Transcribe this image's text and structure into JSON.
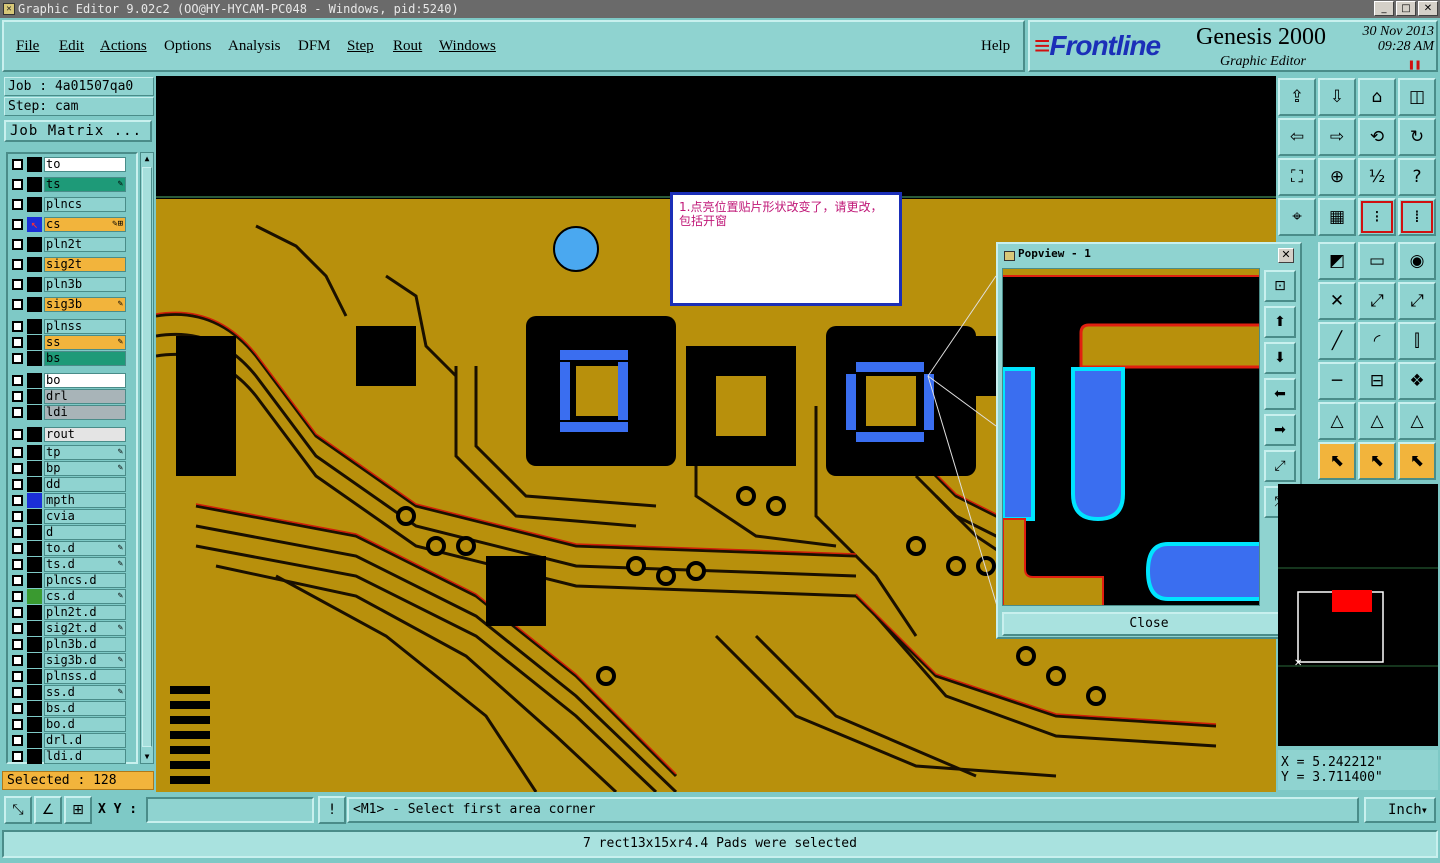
{
  "window": {
    "title": "Graphic Editor 9.02c2 (OO@HY-HYCAM-PC048 - Windows, pid:5240)",
    "min": "_",
    "max": "□",
    "close": "✕"
  },
  "menu": {
    "file": "File",
    "edit": "Edit",
    "actions": "Actions",
    "options": "Options",
    "analysis": "Analysis",
    "dfm": "DFM",
    "step": "Step",
    "rout": "Rout",
    "windows": "Windows",
    "help": "Help"
  },
  "brand": {
    "logo": "Frontline",
    "product": "Genesis 2000",
    "subtitle": "Graphic Editor",
    "date": "30 Nov 2013",
    "time": "09:28 AM",
    "pause_glyph": "❚❚"
  },
  "job": {
    "job_label": "Job : 4a01507qa0",
    "step_label": "Step: cam",
    "matrix_button": "Job Matrix ..."
  },
  "layers": [
    {
      "name": "to",
      "bg": "#ffffff",
      "mark": ""
    },
    {
      "name": "ts",
      "bg": "#1e9a78",
      "mark": "✎"
    },
    {
      "name": "plncs",
      "bg": "#8fd3d0",
      "mark": ""
    },
    {
      "name": "cs",
      "bg": "#f2b43c",
      "mark": "✎⊞",
      "work": true
    },
    {
      "name": "pln2t",
      "bg": "#8fd3d0",
      "mark": ""
    },
    {
      "name": "sig2t",
      "bg": "#f2b43c",
      "mark": ""
    },
    {
      "name": "pln3b",
      "bg": "#8fd3d0",
      "mark": ""
    },
    {
      "name": "sig3b",
      "bg": "#f2b43c",
      "mark": "✎"
    },
    {
      "name": "plnss",
      "bg": "#8fd3d0",
      "mark": ""
    },
    {
      "name": "ss",
      "bg": "#f2b43c",
      "mark": "✎"
    },
    {
      "name": "bs",
      "bg": "#1e9a78",
      "mark": ""
    },
    {
      "name": "bo",
      "bg": "#ffffff",
      "mark": ""
    },
    {
      "name": "drl",
      "bg": "#a8b4b8",
      "mark": ""
    },
    {
      "name": "ldi",
      "bg": "#a8b4b8",
      "mark": ""
    },
    {
      "name": "rout",
      "bg": "#e4e4e4",
      "mark": ""
    },
    {
      "name": "tp",
      "bg": "#8fd3d0",
      "mark": "✎"
    },
    {
      "name": "bp",
      "bg": "#8fd3d0",
      "mark": "✎"
    },
    {
      "name": "dd",
      "bg": "#8fd3d0",
      "mark": ""
    },
    {
      "name": "mpth",
      "bg": "#8fd3d0",
      "mark": "",
      "affect": "#1b2fd8"
    },
    {
      "name": "cvia",
      "bg": "#8fd3d0",
      "mark": ""
    },
    {
      "name": "d",
      "bg": "#8fd3d0",
      "mark": ""
    },
    {
      "name": "to.d",
      "bg": "#8fd3d0",
      "mark": "✎"
    },
    {
      "name": "ts.d",
      "bg": "#8fd3d0",
      "mark": "✎"
    },
    {
      "name": "plncs.d",
      "bg": "#8fd3d0",
      "mark": ""
    },
    {
      "name": "cs.d",
      "bg": "#8fd3d0",
      "mark": "✎",
      "affect": "#3a9a30"
    },
    {
      "name": "pln2t.d",
      "bg": "#8fd3d0",
      "mark": ""
    },
    {
      "name": "sig2t.d",
      "bg": "#8fd3d0",
      "mark": "✎"
    },
    {
      "name": "pln3b.d",
      "bg": "#8fd3d0",
      "mark": ""
    },
    {
      "name": "sig3b.d",
      "bg": "#8fd3d0",
      "mark": "✎"
    },
    {
      "name": "plnss.d",
      "bg": "#8fd3d0",
      "mark": ""
    },
    {
      "name": "ss.d",
      "bg": "#8fd3d0",
      "mark": "✎"
    },
    {
      "name": "bs.d",
      "bg": "#8fd3d0",
      "mark": ""
    },
    {
      "name": "bo.d",
      "bg": "#8fd3d0",
      "mark": ""
    },
    {
      "name": "drl.d",
      "bg": "#8fd3d0",
      "mark": ""
    },
    {
      "name": "ldi.d",
      "bg": "#8fd3d0",
      "mark": ""
    }
  ],
  "selected": "Selected : 128",
  "note": "1.点亮位置贴片形状改变了，请更改，包括开窗",
  "popview": {
    "title": "Popview - 1",
    "close_button": "Close"
  },
  "coords": {
    "x": "X  =  5.242212\"",
    "y": "Y  =  3.711400\""
  },
  "bottom": {
    "xy_label": "X Y :",
    "xy_value": "",
    "prompt": "<M1> - Select first area corner",
    "units": "Inch",
    "units_arrow": "▾",
    "warn": "!"
  },
  "status": "7 rect13x15xr4.4 Pads were selected",
  "colors": {
    "copper": "#b8900c",
    "pad": "#3a6ef0",
    "highlight_outline": "#00e5ff",
    "red_edge": "#e02010"
  }
}
